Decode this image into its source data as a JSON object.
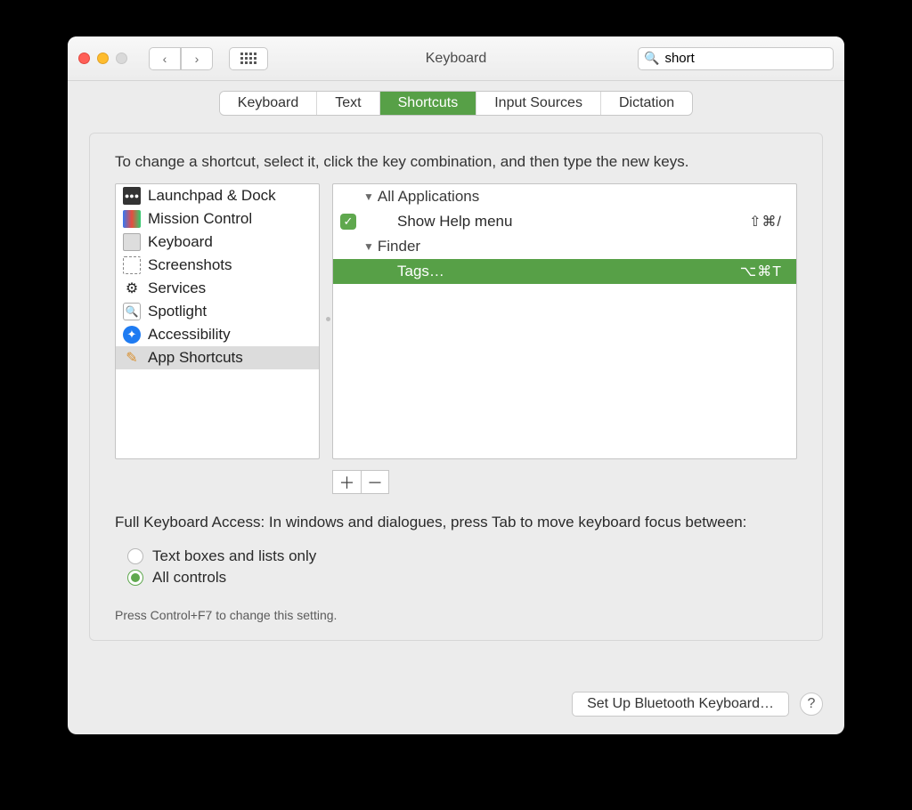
{
  "window": {
    "title": "Keyboard"
  },
  "search": {
    "value": "short",
    "placeholder": "Search"
  },
  "tabs": [
    {
      "label": "Keyboard",
      "active": false
    },
    {
      "label": "Text",
      "active": false
    },
    {
      "label": "Shortcuts",
      "active": true
    },
    {
      "label": "Input Sources",
      "active": false
    },
    {
      "label": "Dictation",
      "active": false
    }
  ],
  "instruction": "To change a shortcut, select it, click the key combination, and then type the new keys.",
  "categories": [
    {
      "label": "Launchpad & Dock",
      "icon": "🚀",
      "selected": false
    },
    {
      "label": "Mission Control",
      "icon": "🗂",
      "selected": false
    },
    {
      "label": "Keyboard",
      "icon": "⌨️",
      "selected": false
    },
    {
      "label": "Screenshots",
      "icon": "🖼",
      "selected": false
    },
    {
      "label": "Services",
      "icon": "⚙️",
      "selected": false
    },
    {
      "label": "Spotlight",
      "icon": "🔍",
      "selected": false
    },
    {
      "label": "Accessibility",
      "icon": "♿︎",
      "selected": false
    },
    {
      "label": "App Shortcuts",
      "icon": "📐",
      "selected": true
    }
  ],
  "shortcuts": {
    "groups": [
      {
        "name": "All Applications",
        "items": [
          {
            "enabled": true,
            "name": "Show Help menu",
            "keys": "⇧⌘/",
            "selected": false
          }
        ]
      },
      {
        "name": "Finder",
        "items": [
          {
            "enabled": true,
            "name": "Tags…",
            "keys": "⌥⌘T",
            "selected": true
          }
        ]
      }
    ]
  },
  "fullKeyboard": {
    "label": "Full Keyboard Access: In windows and dialogues, press Tab to move keyboard focus between:",
    "options": [
      {
        "label": "Text boxes and lists only",
        "checked": false
      },
      {
        "label": "All controls",
        "checked": true
      }
    ],
    "hint": "Press Control+F7 to change this setting."
  },
  "footer": {
    "bluetooth": "Set Up Bluetooth Keyboard…",
    "help": "?"
  },
  "buttons": {
    "add": "＋",
    "remove": "－"
  }
}
